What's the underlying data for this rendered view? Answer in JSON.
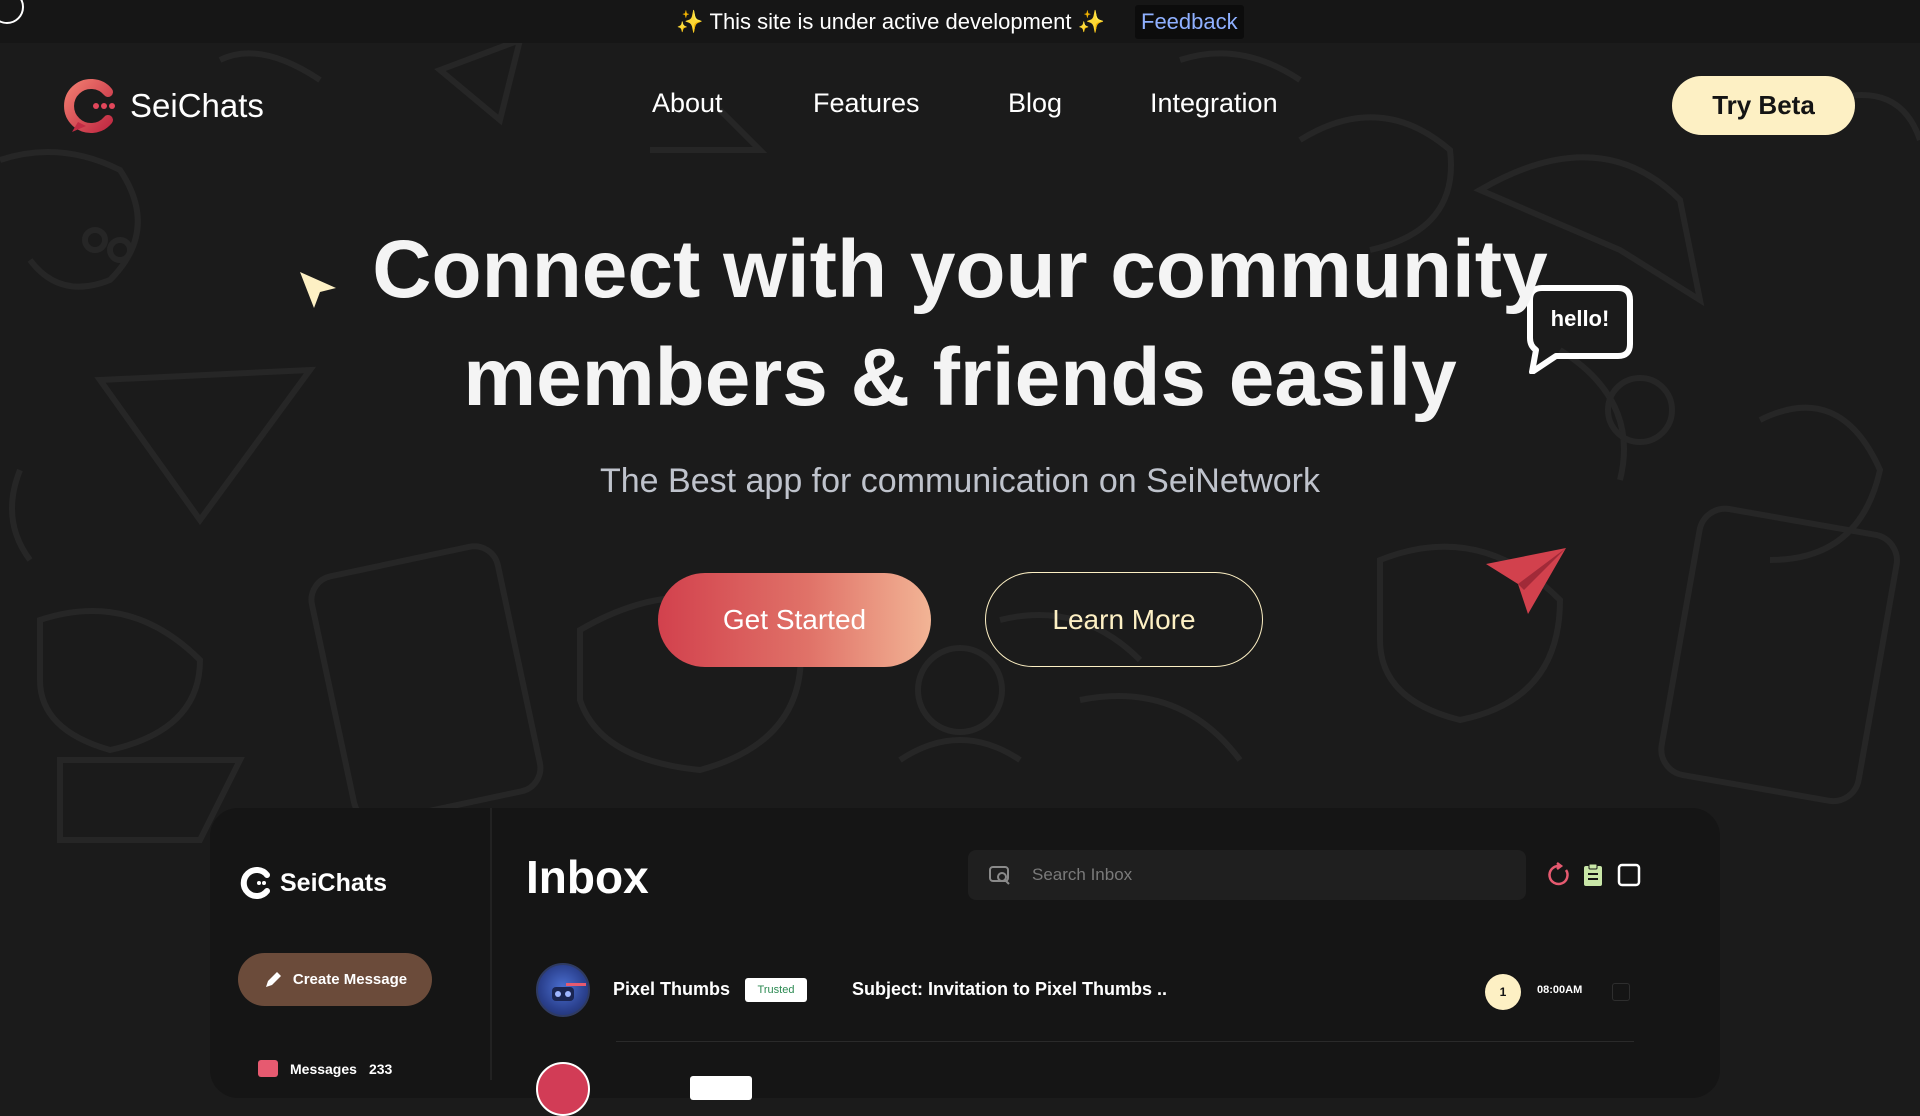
{
  "banner": {
    "sparkle_left": "✨",
    "message": "This site is under active development",
    "sparkle_right": "✨",
    "feedback_label": "Feedback"
  },
  "nav": {
    "brand": "SeiChats",
    "links": [
      "About",
      "Features",
      "Blog",
      "Integration"
    ],
    "cta": "Try Beta"
  },
  "hero": {
    "title_line1": "Connect with your community",
    "title_line2": "members & friends easily",
    "subtitle": "The Best app for communication on SeiNetwork",
    "primary_button": "Get Started",
    "secondary_button": "Learn More",
    "bubble_text": "hello!"
  },
  "app_preview": {
    "brand": "SeiChats",
    "create_button": "Create Message",
    "sidebar_items": [
      {
        "label": "Messages",
        "count": "233"
      }
    ],
    "inbox_title": "Inbox",
    "search_placeholder": "Search Inbox",
    "messages": [
      {
        "sender": "Pixel Thumbs",
        "badge": "Trusted",
        "subject": "Subject: Invitation to Pixel Thumbs ..",
        "unread": "1",
        "time": "08:00AM"
      }
    ]
  },
  "colors": {
    "background": "#1b1b1b",
    "accent_cream": "#fdf0c4",
    "accent_red": "#d2414d",
    "gradient_end": "#f2b495"
  }
}
